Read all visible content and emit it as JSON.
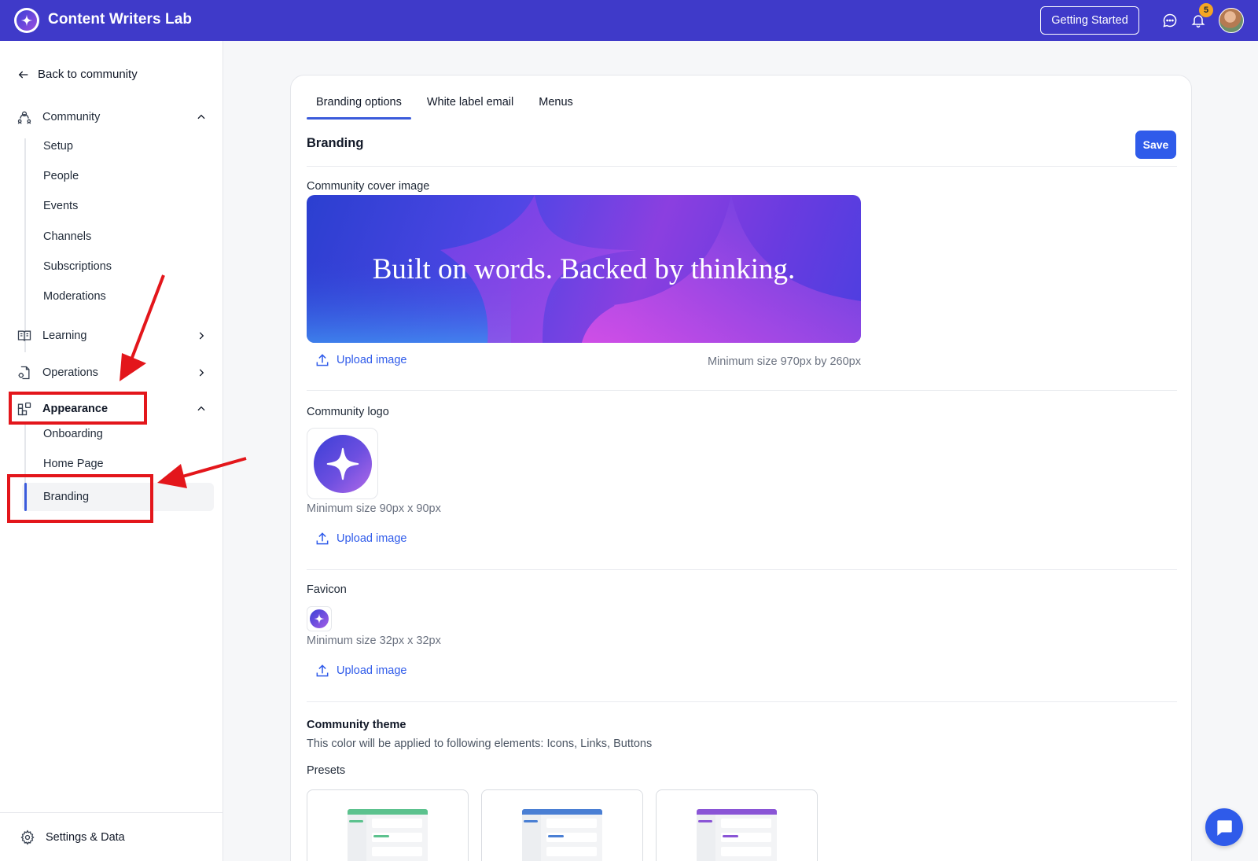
{
  "header": {
    "app_name": "Content Writers Lab",
    "getting_started_label": "Getting Started",
    "notification_count": "5",
    "accent_color": "#3f3ac9"
  },
  "sidebar": {
    "back_label": "Back to community",
    "groups": {
      "community": {
        "label": "Community",
        "icon": "community-icon",
        "expanded": true,
        "items": [
          "Setup",
          "People",
          "Events",
          "Channels",
          "Subscriptions",
          "Moderations"
        ]
      },
      "learning": {
        "label": "Learning",
        "icon": "book-icon",
        "expanded": false
      },
      "operations": {
        "label": "Operations",
        "icon": "document-settings-icon",
        "expanded": false
      },
      "appearance": {
        "label": "Appearance",
        "icon": "layout-icon",
        "expanded": true,
        "items": [
          "Onboarding",
          "Home Page",
          "Branding"
        ],
        "active_item": "Branding"
      }
    },
    "footer_label": "Settings & Data"
  },
  "main": {
    "tabs": [
      "Branding options",
      "White label email",
      "Menus"
    ],
    "active_tab": "Branding options",
    "section_title": "Branding",
    "save_label": "Save",
    "cover": {
      "label": "Community cover image",
      "image_text": "Built on words. Backed by thinking.",
      "upload_label": "Upload image",
      "hint": "Minimum size 970px by 260px"
    },
    "logo": {
      "label": "Community logo",
      "hint": "Minimum size 90px x 90px",
      "upload_label": "Upload image"
    },
    "favicon": {
      "label": "Favicon",
      "hint": "Minimum size 32px x 32px",
      "upload_label": "Upload image"
    },
    "theme": {
      "title": "Community theme",
      "description": "This color will be applied to following elements: Icons, Links, Buttons",
      "presets_label": "Presets",
      "preset_colors": [
        "#5cc28e",
        "#4a7fd4",
        "#8a55d6"
      ]
    },
    "primary_color": "#2f5bea"
  }
}
